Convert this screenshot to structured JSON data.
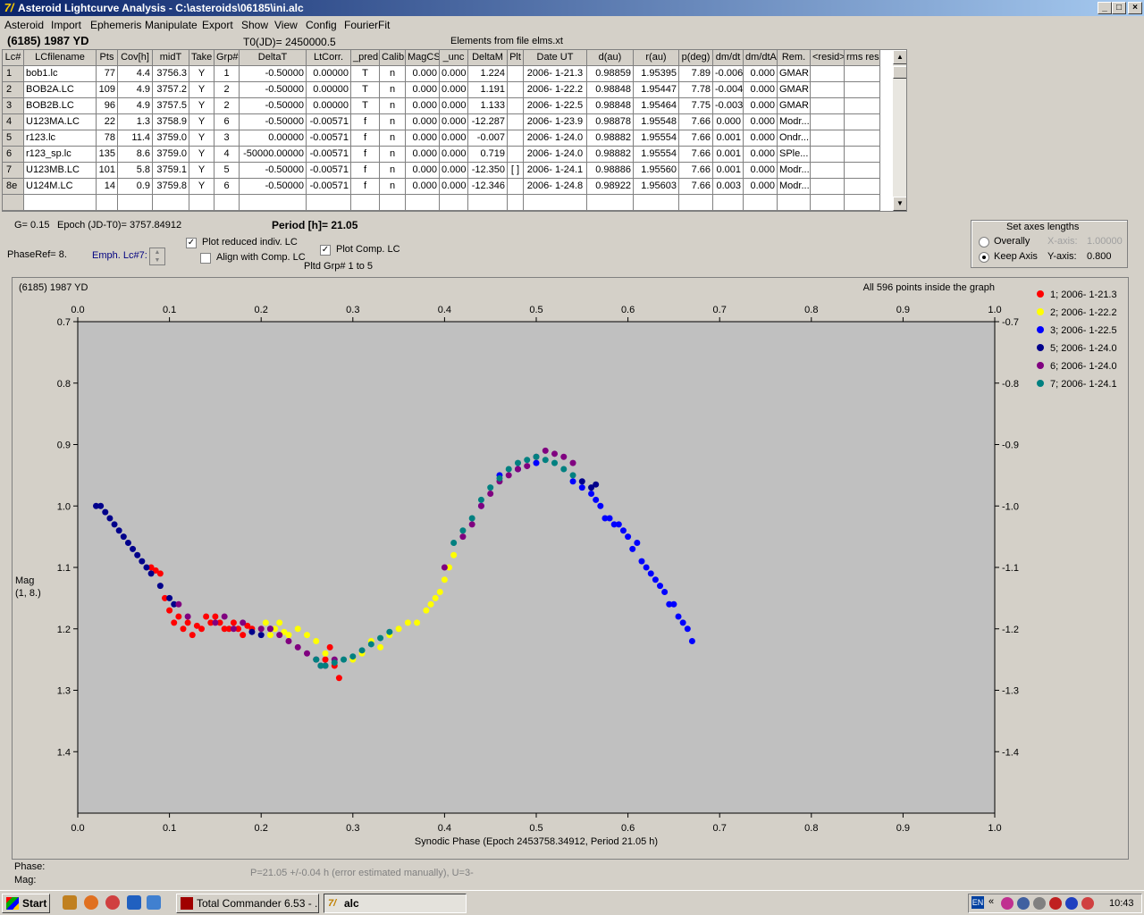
{
  "window": {
    "title": "Asteroid Lightcurve Analysis - C:\\asteroids\\06185\\ini.alc",
    "controls": [
      "_",
      "□",
      "×"
    ]
  },
  "menu": [
    "Asteroid",
    "Import",
    "Ephemeris",
    "Manipulate",
    "Export",
    "Show",
    "View",
    "Config",
    "FourierFit"
  ],
  "header": {
    "asteroid": "(6185) 1987 YD",
    "t0": "T0(JD)= 2450000.5",
    "elements": "Elements from file elms.xt"
  },
  "table": {
    "columns": [
      "Lc#",
      "LCfilename",
      "Pts",
      "Cov[h]",
      "midT",
      "Take",
      "Grp#",
      "DeltaT",
      "LtCorr.",
      "_pred.",
      "Calib.",
      "MagCS",
      "_unc",
      "DeltaM",
      "Plt",
      "Date UT",
      "d(au)",
      "r(au)",
      "p(deg)",
      "dm/dt",
      "dm/dtA",
      "Rem.",
      "<resid>",
      "rms res"
    ],
    "rows": [
      [
        "1",
        "bob1.lc",
        "77",
        "4.4",
        "3756.3",
        "Y",
        "1",
        "-0.50000",
        "0.00000",
        "T",
        "n",
        "0.000",
        "0.000",
        "1.224",
        "",
        "2006- 1-21.3",
        "0.98859",
        "1.95395",
        "7.89",
        "-0.006",
        "0.000",
        "GMAR",
        "",
        ""
      ],
      [
        "2",
        "BOB2A.LC",
        "109",
        "4.9",
        "3757.2",
        "Y",
        "2",
        "-0.50000",
        "0.00000",
        "T",
        "n",
        "0.000",
        "0.000",
        "1.191",
        "",
        "2006- 1-22.2",
        "0.98848",
        "1.95447",
        "7.78",
        "-0.004",
        "0.000",
        "GMAR",
        "",
        ""
      ],
      [
        "3",
        "BOB2B.LC",
        "96",
        "4.9",
        "3757.5",
        "Y",
        "2",
        "-0.50000",
        "0.00000",
        "T",
        "n",
        "0.000",
        "0.000",
        "1.133",
        "",
        "2006- 1-22.5",
        "0.98848",
        "1.95464",
        "7.75",
        "-0.003",
        "0.000",
        "GMAR",
        "",
        ""
      ],
      [
        "4",
        "U123MA.LC",
        "22",
        "1.3",
        "3758.9",
        "Y",
        "6",
        "-0.50000",
        "-0.00571",
        "f",
        "n",
        "0.000",
        "0.000",
        "-12.287",
        "",
        "2006- 1-23.9",
        "0.98878",
        "1.95548",
        "7.66",
        "0.000",
        "0.000",
        "Modr...",
        "",
        ""
      ],
      [
        "5",
        "r123.lc",
        "78",
        "11.4",
        "3759.0",
        "Y",
        "3",
        "0.00000",
        "-0.00571",
        "f",
        "n",
        "0.000",
        "0.000",
        "-0.007",
        "",
        "2006- 1-24.0",
        "0.98882",
        "1.95554",
        "7.66",
        "0.001",
        "0.000",
        "Ondr...",
        "",
        ""
      ],
      [
        "6",
        "r123_sp.lc",
        "135",
        "8.6",
        "3759.0",
        "Y",
        "4",
        "-50000.00000",
        "-0.00571",
        "f",
        "n",
        "0.000",
        "0.000",
        "0.719",
        "",
        "2006- 1-24.0",
        "0.98882",
        "1.95554",
        "7.66",
        "0.001",
        "0.000",
        "SPle...",
        "",
        ""
      ],
      [
        "7",
        "U123MB.LC",
        "101",
        "5.8",
        "3759.1",
        "Y",
        "5",
        "-0.50000",
        "-0.00571",
        "f",
        "n",
        "0.000",
        "0.000",
        "-12.350",
        "[ ]",
        "2006- 1-24.1",
        "0.98886",
        "1.95560",
        "7.66",
        "0.001",
        "0.000",
        "Modr...",
        "",
        ""
      ],
      [
        "8e",
        "U124M.LC",
        "14",
        "0.9",
        "3759.8",
        "Y",
        "6",
        "-0.50000",
        "-0.00571",
        "f",
        "n",
        "0.000",
        "0.000",
        "-12.346",
        "",
        "2006- 1-24.8",
        "0.98922",
        "1.95603",
        "7.66",
        "0.003",
        "0.000",
        "Modr...",
        "",
        ""
      ]
    ]
  },
  "params": {
    "g": "G= 0.15",
    "epoch": "Epoch (JD-T0)= 3757.84912",
    "period": "Period [h]= 21.05",
    "phaseref": "PhaseRef= 8.",
    "emph": "Emph. Lc#7:",
    "plot_reduced": "Plot reduced indiv. LC",
    "align_comp": "Align with Comp. LC",
    "plot_comp": "Plot Comp. LC",
    "pltd_grp": "Pltd Grp#  1   to   5"
  },
  "axes_box": {
    "title": "Set axes lengths",
    "overally": "Overally",
    "keep_axis": "Keep Axis",
    "x_axis_label": "X-axis:",
    "x_axis_value": "1.00000",
    "y_axis_label": "Y-axis:",
    "y_axis_value": "0.800"
  },
  "plot_meta": {
    "object": "(6185) 1987 YD",
    "points_info": "All 596 points inside the graph",
    "phase_label": "Phase:",
    "mag_label": "Mag:",
    "status": "P=21.05 +/-0.04 h (error estimated manually), U=3-"
  },
  "chart_data": {
    "type": "scatter",
    "title": "",
    "xlabel": "Synodic Phase (Epoch 2453758.34912, Period 21.05 h)",
    "ylabel": "Mag\n(1, 8.)",
    "xlim": [
      0.0,
      1.0
    ],
    "ylim": [
      0.7,
      1.5
    ],
    "y_inverted": true,
    "grid": false,
    "legend_position": "right",
    "xticks": [
      "0.0",
      "0.1",
      "0.2",
      "0.3",
      "0.4",
      "0.5",
      "0.6",
      "0.7",
      "0.8",
      "0.9",
      "1.0"
    ],
    "yticks": [
      "0.7",
      "0.8",
      "0.9",
      "1.0",
      "1.1",
      "1.2",
      "1.3",
      "1.4"
    ],
    "series": [
      {
        "name": "1; 2006- 1-21.3",
        "color": "#ff0000",
        "points": [
          [
            0.08,
            1.1
          ],
          [
            0.085,
            1.105
          ],
          [
            0.09,
            1.11
          ],
          [
            0.095,
            1.15
          ],
          [
            0.1,
            1.17
          ],
          [
            0.105,
            1.19
          ],
          [
            0.11,
            1.18
          ],
          [
            0.115,
            1.2
          ],
          [
            0.12,
            1.19
          ],
          [
            0.125,
            1.21
          ],
          [
            0.13,
            1.195
          ],
          [
            0.135,
            1.2
          ],
          [
            0.14,
            1.18
          ],
          [
            0.145,
            1.19
          ],
          [
            0.15,
            1.18
          ],
          [
            0.155,
            1.19
          ],
          [
            0.16,
            1.2
          ],
          [
            0.165,
            1.2
          ],
          [
            0.17,
            1.19
          ],
          [
            0.175,
            1.2
          ],
          [
            0.18,
            1.21
          ],
          [
            0.185,
            1.195
          ],
          [
            0.19,
            1.2
          ],
          [
            0.27,
            1.25
          ],
          [
            0.275,
            1.23
          ],
          [
            0.28,
            1.26
          ],
          [
            0.285,
            1.28
          ]
        ]
      },
      {
        "name": "2; 2006- 1-22.2",
        "color": "#ffff00",
        "points": [
          [
            0.2,
            1.2
          ],
          [
            0.205,
            1.19
          ],
          [
            0.21,
            1.21
          ],
          [
            0.215,
            1.2
          ],
          [
            0.22,
            1.19
          ],
          [
            0.225,
            1.205
          ],
          [
            0.23,
            1.21
          ],
          [
            0.24,
            1.2
          ],
          [
            0.25,
            1.21
          ],
          [
            0.26,
            1.22
          ],
          [
            0.27,
            1.24
          ],
          [
            0.3,
            1.25
          ],
          [
            0.31,
            1.24
          ],
          [
            0.32,
            1.22
          ],
          [
            0.33,
            1.23
          ],
          [
            0.34,
            1.21
          ],
          [
            0.35,
            1.2
          ],
          [
            0.36,
            1.19
          ],
          [
            0.37,
            1.19
          ],
          [
            0.38,
            1.17
          ],
          [
            0.385,
            1.16
          ],
          [
            0.39,
            1.15
          ],
          [
            0.395,
            1.14
          ],
          [
            0.4,
            1.12
          ],
          [
            0.405,
            1.1
          ],
          [
            0.41,
            1.08
          ]
        ]
      },
      {
        "name": "3; 2006- 1-22.5",
        "color": "#0000ff",
        "points": [
          [
            0.54,
            0.96
          ],
          [
            0.55,
            0.97
          ],
          [
            0.56,
            0.98
          ],
          [
            0.565,
            0.99
          ],
          [
            0.57,
            1.0
          ],
          [
            0.575,
            1.02
          ],
          [
            0.58,
            1.02
          ],
          [
            0.585,
            1.03
          ],
          [
            0.59,
            1.03
          ],
          [
            0.595,
            1.04
          ],
          [
            0.6,
            1.05
          ],
          [
            0.605,
            1.07
          ],
          [
            0.61,
            1.06
          ],
          [
            0.615,
            1.09
          ],
          [
            0.62,
            1.1
          ],
          [
            0.625,
            1.11
          ],
          [
            0.63,
            1.12
          ],
          [
            0.635,
            1.13
          ],
          [
            0.64,
            1.14
          ],
          [
            0.645,
            1.16
          ],
          [
            0.65,
            1.16
          ],
          [
            0.655,
            1.18
          ],
          [
            0.66,
            1.19
          ],
          [
            0.665,
            1.2
          ],
          [
            0.67,
            1.22
          ],
          [
            0.44,
            1.0
          ],
          [
            0.46,
            0.95
          ],
          [
            0.48,
            0.94
          ],
          [
            0.5,
            0.93
          ]
        ]
      },
      {
        "name": "5; 2006- 1-24.0",
        "color": "#00008b",
        "points": [
          [
            0.02,
            1.0
          ],
          [
            0.025,
            1.0
          ],
          [
            0.03,
            1.01
          ],
          [
            0.035,
            1.02
          ],
          [
            0.04,
            1.03
          ],
          [
            0.045,
            1.04
          ],
          [
            0.05,
            1.05
          ],
          [
            0.055,
            1.06
          ],
          [
            0.06,
            1.07
          ],
          [
            0.065,
            1.08
          ],
          [
            0.07,
            1.09
          ],
          [
            0.075,
            1.1
          ],
          [
            0.08,
            1.11
          ],
          [
            0.09,
            1.13
          ],
          [
            0.1,
            1.15
          ],
          [
            0.105,
            1.16
          ],
          [
            0.19,
            1.205
          ],
          [
            0.2,
            1.21
          ],
          [
            0.21,
            1.2
          ],
          [
            0.55,
            0.96
          ],
          [
            0.56,
            0.97
          ],
          [
            0.565,
            0.965
          ]
        ]
      },
      {
        "name": "6; 2006- 1-24.0",
        "color": "#800080",
        "points": [
          [
            0.11,
            1.16
          ],
          [
            0.12,
            1.18
          ],
          [
            0.15,
            1.19
          ],
          [
            0.16,
            1.18
          ],
          [
            0.17,
            1.2
          ],
          [
            0.18,
            1.19
          ],
          [
            0.2,
            1.2
          ],
          [
            0.21,
            1.2
          ],
          [
            0.22,
            1.21
          ],
          [
            0.23,
            1.22
          ],
          [
            0.24,
            1.23
          ],
          [
            0.25,
            1.24
          ],
          [
            0.26,
            1.25
          ],
          [
            0.265,
            1.26
          ],
          [
            0.27,
            1.26
          ],
          [
            0.28,
            1.25
          ],
          [
            0.4,
            1.1
          ],
          [
            0.42,
            1.05
          ],
          [
            0.43,
            1.03
          ],
          [
            0.44,
            1.0
          ],
          [
            0.45,
            0.98
          ],
          [
            0.46,
            0.96
          ],
          [
            0.47,
            0.95
          ],
          [
            0.48,
            0.94
          ],
          [
            0.49,
            0.935
          ],
          [
            0.5,
            0.92
          ],
          [
            0.51,
            0.91
          ],
          [
            0.52,
            0.915
          ],
          [
            0.53,
            0.92
          ],
          [
            0.54,
            0.93
          ]
        ]
      },
      {
        "name": "7; 2006- 1-24.1",
        "color": "#008080",
        "points": [
          [
            0.26,
            1.25
          ],
          [
            0.265,
            1.26
          ],
          [
            0.27,
            1.26
          ],
          [
            0.28,
            1.255
          ],
          [
            0.29,
            1.25
          ],
          [
            0.3,
            1.245
          ],
          [
            0.31,
            1.235
          ],
          [
            0.32,
            1.225
          ],
          [
            0.33,
            1.215
          ],
          [
            0.34,
            1.205
          ],
          [
            0.41,
            1.06
          ],
          [
            0.42,
            1.04
          ],
          [
            0.43,
            1.02
          ],
          [
            0.44,
            0.99
          ],
          [
            0.45,
            0.97
          ],
          [
            0.46,
            0.955
          ],
          [
            0.47,
            0.94
          ],
          [
            0.48,
            0.93
          ],
          [
            0.49,
            0.925
          ],
          [
            0.5,
            0.92
          ],
          [
            0.51,
            0.925
          ],
          [
            0.52,
            0.93
          ],
          [
            0.53,
            0.94
          ],
          [
            0.54,
            0.95
          ]
        ]
      }
    ]
  },
  "taskbar": {
    "start": "Start",
    "task1": "Total Commander 6.53 - ...",
    "task2": "alc",
    "lang": "EN",
    "time": "10:43"
  }
}
